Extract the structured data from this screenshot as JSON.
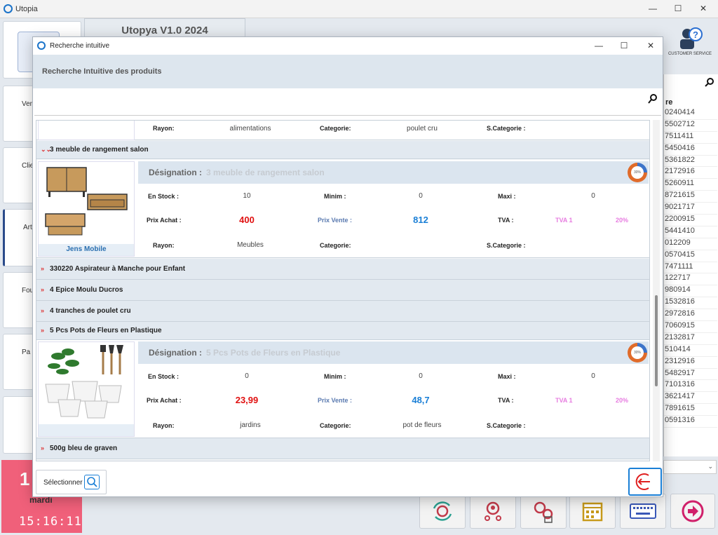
{
  "main": {
    "title": "Utopia",
    "version": "Utopya V1.0 2024",
    "customer_service": "CUSTOMER SERVICE",
    "side_tiles": [
      "Ven",
      "Clier",
      "Art",
      "Fou",
      "Pa"
    ],
    "right_panel": {
      "header": "re",
      "items": [
        "0240414",
        "5502712",
        "7511411",
        "5450416",
        "5361822",
        "2172916",
        "5260911",
        "8721615",
        "9021717",
        "2200915",
        "5441410",
        "012209",
        "0570415",
        "7471111",
        "122717",
        "980914",
        "1532816",
        "2972816",
        "7060915",
        "2132817",
        "510414",
        "2312916",
        "5482917",
        "7101316",
        "3621417",
        "7891615",
        "0591316"
      ]
    },
    "date": {
      "day": "1",
      "day_name": "mardi",
      "time": "15:16:11"
    }
  },
  "dialog": {
    "title": "Recherche intuitive",
    "header": "Recherche Intuitive des produits",
    "search": {
      "value": "",
      "placeholder": ""
    },
    "labels": {
      "rayon": "Rayon:",
      "categorie": "Categorie:",
      "scategorie": "S.Categorie :",
      "designation": "Désignation :",
      "en_stock": "En Stock :",
      "minim": "Minim :",
      "maxi": "Maxi :",
      "prix_achat": "Prix Achat :",
      "prix_vente": "Prix Vente :",
      "tva": "TVA :"
    },
    "partial_row": {
      "rayon": "alimentations",
      "categorie": "poulet cru",
      "scategorie": ""
    },
    "products": [
      {
        "name": "3 meuble de rangement salon",
        "designation": "3 meuble de rangement salon",
        "brand": "Jens Mobile",
        "en_stock": "10",
        "minim": "0",
        "maxi": "0",
        "prix_achat": "400",
        "prix_vente": "812",
        "tva_name": "TVA 1",
        "tva_rate": "20%",
        "rayon": "Meubles",
        "categorie": "",
        "scategorie": ""
      },
      {
        "name": "330220 Aspirateur à Manche pour Enfant"
      },
      {
        "name": "4 Epice Moulu Ducros"
      },
      {
        "name": "4 tranches de poulet cru"
      },
      {
        "name": "5 Pcs Pots de Fleurs en Plastique",
        "designation": "5 Pcs Pots de Fleurs en Plastique",
        "brand": "",
        "en_stock": "0",
        "minim": "0",
        "maxi": "0",
        "prix_achat": "23,99",
        "prix_vente": "48,7",
        "tva_name": "TVA 1",
        "tva_rate": "20%",
        "rayon": "jardins",
        "categorie": "pot de fleurs",
        "scategorie": ""
      },
      {
        "name": "500g bleu de graven"
      }
    ],
    "gauge_text": "30%",
    "select_label": "Sélectionner"
  },
  "colors": {
    "accent": "#1a7fd6",
    "price_buy": "#e01010",
    "tva": "#e77ce0",
    "date_tile": "#f0607a"
  }
}
